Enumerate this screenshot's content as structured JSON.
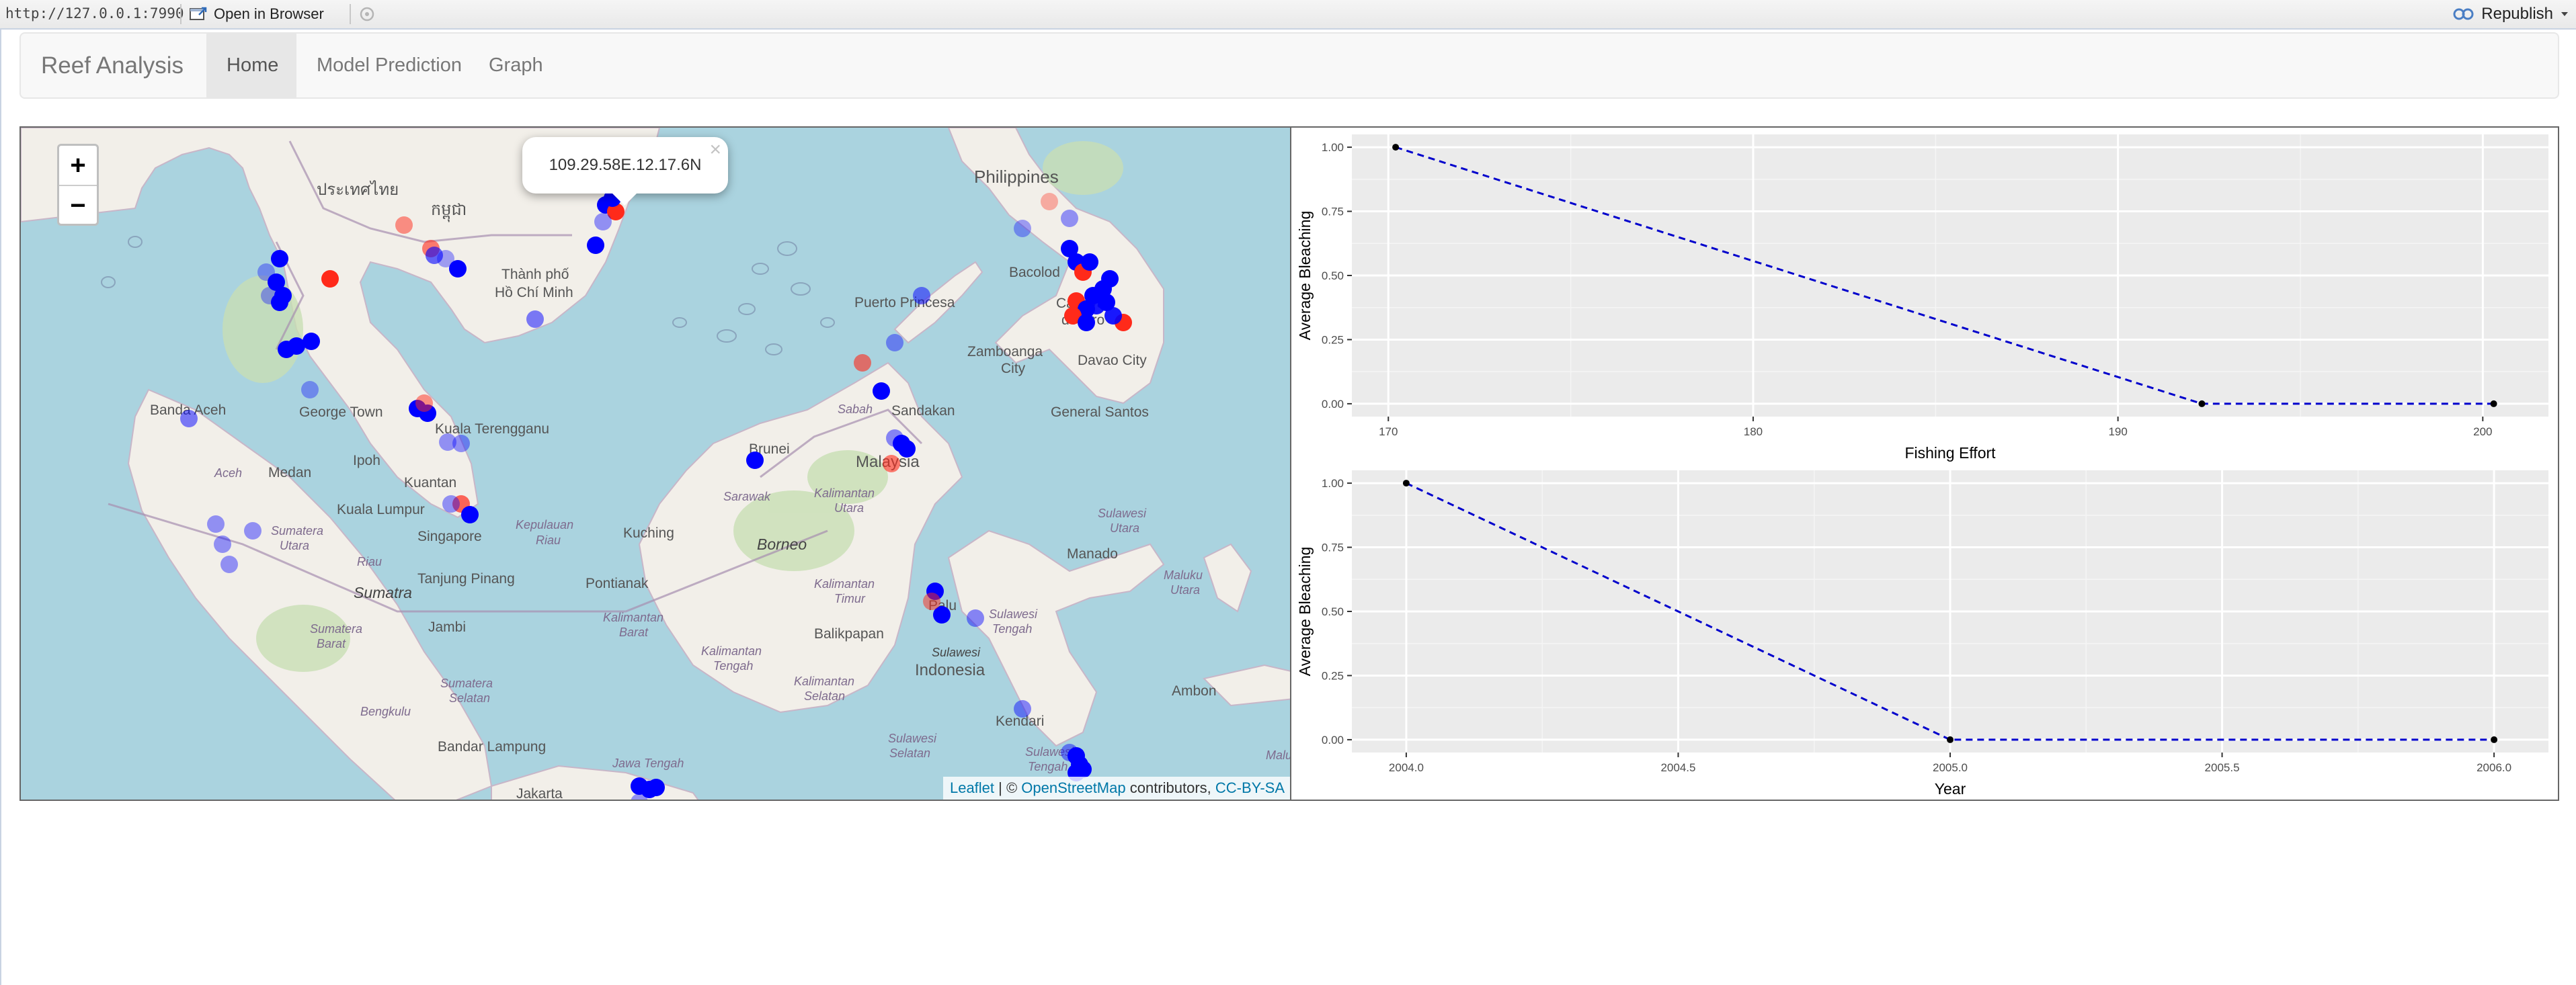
{
  "viewer": {
    "url": "http://127.0.0.1:7990",
    "open_in_browser_label": "Open in Browser",
    "publish_label": "Republish"
  },
  "navbar": {
    "brand": "Reef Analysis",
    "tabs": [
      {
        "label": "Home",
        "active": true
      },
      {
        "label": "Model Prediction",
        "active": false
      },
      {
        "label": "Graph",
        "active": false
      }
    ]
  },
  "map": {
    "zoom_in": "+",
    "zoom_out": "−",
    "popup_text": "109.29.58E.12.17.6N",
    "popup_close": "×",
    "attribution": {
      "leaflet": "Leaflet",
      "sep": " | © ",
      "osm": "OpenStreetMap",
      "contributors": " contributors, ",
      "license": "CC-BY-SA"
    },
    "place_labels": [
      {
        "text": "Philippines",
        "style": "country"
      },
      {
        "text": "ประเทศไทย",
        "style": "country"
      },
      {
        "text": "កម្ពុជា",
        "style": "country"
      },
      {
        "text": "Thành phố",
        "style": "city"
      },
      {
        "text": "Hồ Chí Minh",
        "style": "city"
      },
      {
        "text": "Puerto Princesa",
        "style": "city"
      },
      {
        "text": "Bacolod",
        "style": "city"
      },
      {
        "text": "Cagayan",
        "style": "city"
      },
      {
        "text": "de Oro",
        "style": "city"
      },
      {
        "text": "Zamboanga",
        "style": "city"
      },
      {
        "text": "City",
        "style": "city"
      },
      {
        "text": "Davao City",
        "style": "city"
      },
      {
        "text": "General Santos",
        "style": "city"
      },
      {
        "text": "Banda Aceh",
        "style": "city"
      },
      {
        "text": "George Town",
        "style": "city"
      },
      {
        "text": "Kuala Terengganu",
        "style": "city"
      },
      {
        "text": "Sandakan",
        "style": "city"
      },
      {
        "text": "Sabah",
        "style": "region"
      },
      {
        "text": "Aceh",
        "style": "region"
      },
      {
        "text": "Medan",
        "style": "city"
      },
      {
        "text": "Ipoh",
        "style": "city"
      },
      {
        "text": "Kuantan",
        "style": "city"
      },
      {
        "text": "Brunei",
        "style": "city"
      },
      {
        "text": "Malaysia",
        "style": "country"
      },
      {
        "text": "Sarawak",
        "style": "region"
      },
      {
        "text": "Kalimantan",
        "style": "region"
      },
      {
        "text": "Utara",
        "style": "region"
      },
      {
        "text": "Kuala Lumpur",
        "style": "city"
      },
      {
        "text": "Singapore",
        "style": "city"
      },
      {
        "text": "Kepulauan",
        "style": "region"
      },
      {
        "text": "Riau",
        "style": "region"
      },
      {
        "text": "Sumatera",
        "style": "region"
      },
      {
        "text": "Utara",
        "style": "region"
      },
      {
        "text": "Riau",
        "style": "region"
      },
      {
        "text": "Kuching",
        "style": "city"
      },
      {
        "text": "Borneo",
        "style": "island"
      },
      {
        "text": "Sulawesi",
        "style": "region"
      },
      {
        "text": "Utara",
        "style": "region"
      },
      {
        "text": "Tanjung Pinang",
        "style": "city"
      },
      {
        "text": "Manado",
        "style": "city"
      },
      {
        "text": "Pontianak",
        "style": "city"
      },
      {
        "text": "Kalimantan",
        "style": "region"
      },
      {
        "text": "Timur",
        "style": "region"
      },
      {
        "text": "Maluku",
        "style": "region"
      },
      {
        "text": "Utara",
        "style": "region"
      },
      {
        "text": "Sumatra",
        "style": "island"
      },
      {
        "text": "Palu",
        "style": "city"
      },
      {
        "text": "Sulawesi",
        "style": "region"
      },
      {
        "text": "Tengah",
        "style": "region"
      },
      {
        "text": "Sumatera",
        "style": "region"
      },
      {
        "text": "Barat",
        "style": "region"
      },
      {
        "text": "Jambi",
        "style": "city"
      },
      {
        "text": "Kalimantan",
        "style": "region"
      },
      {
        "text": "Barat",
        "style": "region"
      },
      {
        "text": "Balikpapan",
        "style": "city"
      },
      {
        "text": "Indonesia",
        "style": "country"
      },
      {
        "text": "Sulawesi",
        "style": "island"
      },
      {
        "text": "Kalimantan",
        "style": "region"
      },
      {
        "text": "Tengah",
        "style": "region"
      },
      {
        "text": "Kalimantan",
        "style": "region"
      },
      {
        "text": "Selatan",
        "style": "region"
      },
      {
        "text": "Sumatera",
        "style": "region"
      },
      {
        "text": "Selatan",
        "style": "region"
      },
      {
        "text": "Bengkulu",
        "style": "region"
      },
      {
        "text": "Ambon",
        "style": "city"
      },
      {
        "text": "Kendari",
        "style": "city"
      },
      {
        "text": "Sulawesi",
        "style": "region"
      },
      {
        "text": "Selatan",
        "style": "region"
      },
      {
        "text": "Sulawesi",
        "style": "region"
      },
      {
        "text": "Tengah",
        "style": "region"
      },
      {
        "text": "Bandar Lampung",
        "style": "city"
      },
      {
        "text": "Jakarta",
        "style": "city"
      },
      {
        "text": "Jawa Tengah",
        "style": "region"
      },
      {
        "text": "Malu",
        "style": "region"
      }
    ],
    "marker_colors": {
      "high": "#0000ff",
      "low": "#ff2a1a"
    }
  },
  "chart_data": [
    {
      "type": "line",
      "x": [
        170.2,
        192.3,
        200.3
      ],
      "y": [
        1.0,
        0.0,
        0.0
      ],
      "xlabel": "Fishing Effort",
      "ylabel": "Average Bleaching",
      "xlim": [
        169,
        201.8
      ],
      "ylim": [
        -0.05,
        1.05
      ],
      "xticks": [
        "170",
        "180",
        "190",
        "200"
      ],
      "xtick_values": [
        170,
        180,
        190,
        200
      ],
      "yticks": [
        "0.00",
        "0.25",
        "0.50",
        "0.75",
        "1.00"
      ],
      "ytick_values": [
        0,
        0.25,
        0.5,
        0.75,
        1.0
      ],
      "line_style": "dashed",
      "line_color": "#0000cc",
      "grid": true
    },
    {
      "type": "line",
      "x": [
        2004.0,
        2005.0,
        2006.0
      ],
      "y": [
        1.0,
        0.0,
        0.0
      ],
      "xlabel": "Year",
      "ylabel": "Average Bleaching",
      "xlim": [
        2003.9,
        2006.1
      ],
      "ylim": [
        -0.05,
        1.05
      ],
      "xticks": [
        "2004.0",
        "2004.5",
        "2005.0",
        "2005.5",
        "2006.0"
      ],
      "xtick_values": [
        2004.0,
        2004.5,
        2005.0,
        2005.5,
        2006.0
      ],
      "yticks": [
        "0.00",
        "0.25",
        "0.50",
        "0.75",
        "1.00"
      ],
      "ytick_values": [
        0,
        0.25,
        0.5,
        0.75,
        1.0
      ],
      "line_style": "dashed",
      "line_color": "#0000cc",
      "grid": true
    }
  ]
}
